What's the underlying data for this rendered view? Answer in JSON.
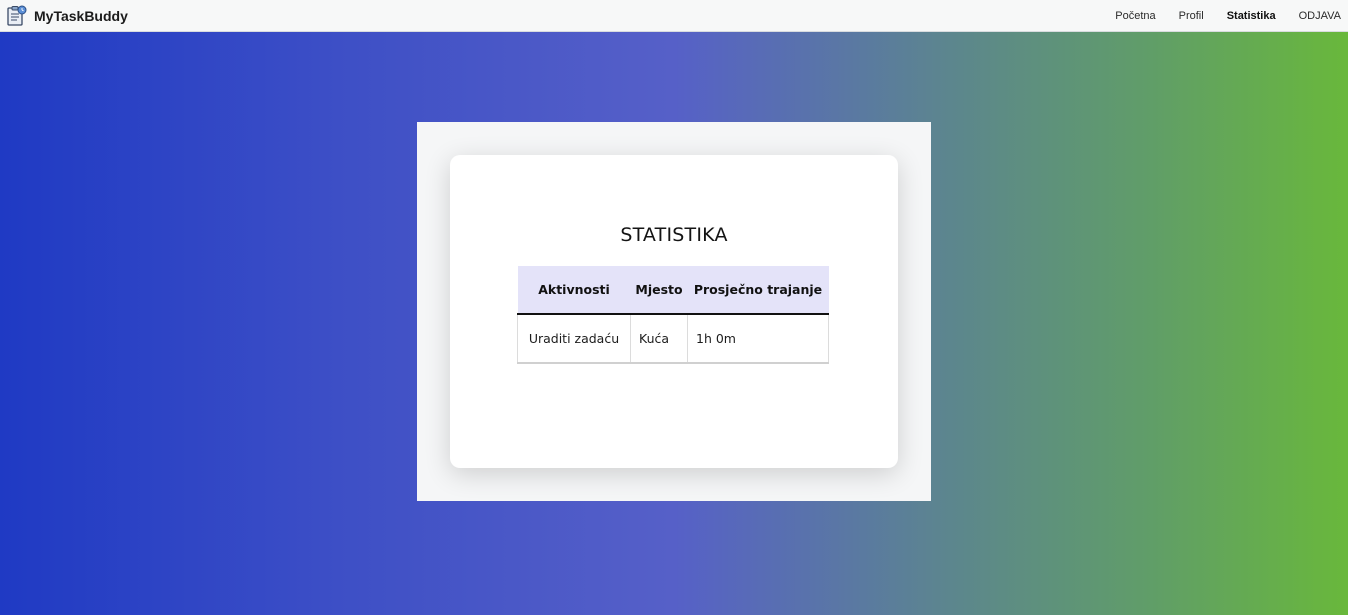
{
  "app": {
    "title": "MyTaskBuddy",
    "logo_icon": "task-clipboard-icon"
  },
  "nav": {
    "items": [
      {
        "label": "Početna",
        "active": false
      },
      {
        "label": "Profil",
        "active": false
      },
      {
        "label": "Statistika",
        "active": true
      },
      {
        "label": "ODJAVA",
        "active": false
      }
    ]
  },
  "main": {
    "heading": "STATISTIKA",
    "table": {
      "headers": [
        "Aktivnosti",
        "Mjesto",
        "Prosječno trajanje"
      ],
      "rows": [
        [
          "Uraditi zadaću",
          "Kuća",
          "1h 0m"
        ]
      ]
    }
  },
  "colors": {
    "gradient_start": "#1f3ac4",
    "gradient_mid": "#5660c8",
    "gradient_end": "#69b83b",
    "table_header_bg": "#e4e3f9"
  }
}
